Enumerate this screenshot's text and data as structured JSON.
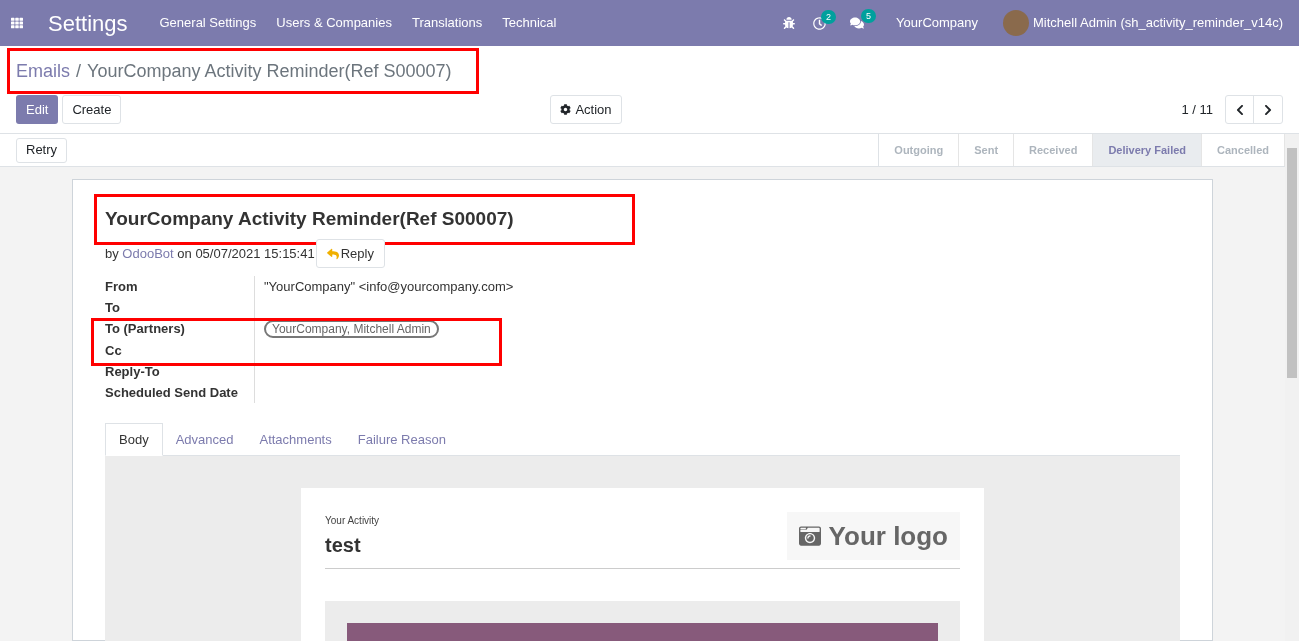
{
  "navbar": {
    "app": "Settings",
    "menu": [
      "General Settings",
      "Users & Companies",
      "Translations",
      "Technical"
    ],
    "activity_count": "2",
    "message_count": "5",
    "company": "YourCompany",
    "user": "Mitchell Admin (sh_activity_reminder_v14c)"
  },
  "breadcrumb": {
    "parent": "Emails",
    "separator": "/",
    "current": "YourCompany Activity Reminder(Ref S00007)"
  },
  "buttons": {
    "edit": "Edit",
    "create": "Create",
    "action": "Action",
    "retry": "Retry"
  },
  "pager": "1 / 11",
  "stages": [
    {
      "label": "Outgoing",
      "selected": false
    },
    {
      "label": "Sent",
      "selected": false
    },
    {
      "label": "Received",
      "selected": false
    },
    {
      "label": "Delivery Failed",
      "selected": true
    },
    {
      "label": "Cancelled",
      "selected": false
    }
  ],
  "message": {
    "subject": "YourCompany Activity Reminder(Ref S00007)",
    "by": "by",
    "author": "OdooBot",
    "on": "on 05/07/2021 15:15:41",
    "reply": "Reply"
  },
  "fields": [
    {
      "label": "From",
      "kind": "text",
      "value": "\"YourCompany\" <info@yourcompany.com>"
    },
    {
      "label": "To",
      "kind": "text"
    },
    {
      "label": "To (Partners)",
      "kind": "tag",
      "value": "YourCompany, Mitchell Admin"
    },
    {
      "label": "Cc",
      "kind": "text"
    },
    {
      "label": "Reply-To",
      "kind": "text"
    },
    {
      "label": "Scheduled Send Date",
      "kind": "text"
    }
  ],
  "tabs": [
    {
      "label": "Body",
      "selected": true
    },
    {
      "label": "Advanced",
      "selected": false
    },
    {
      "label": "Attachments",
      "selected": false
    },
    {
      "label": "Failure Reason",
      "selected": false
    }
  ],
  "body": {
    "caption": "Your Activity",
    "heading": "test",
    "logo": "Your logo"
  }
}
